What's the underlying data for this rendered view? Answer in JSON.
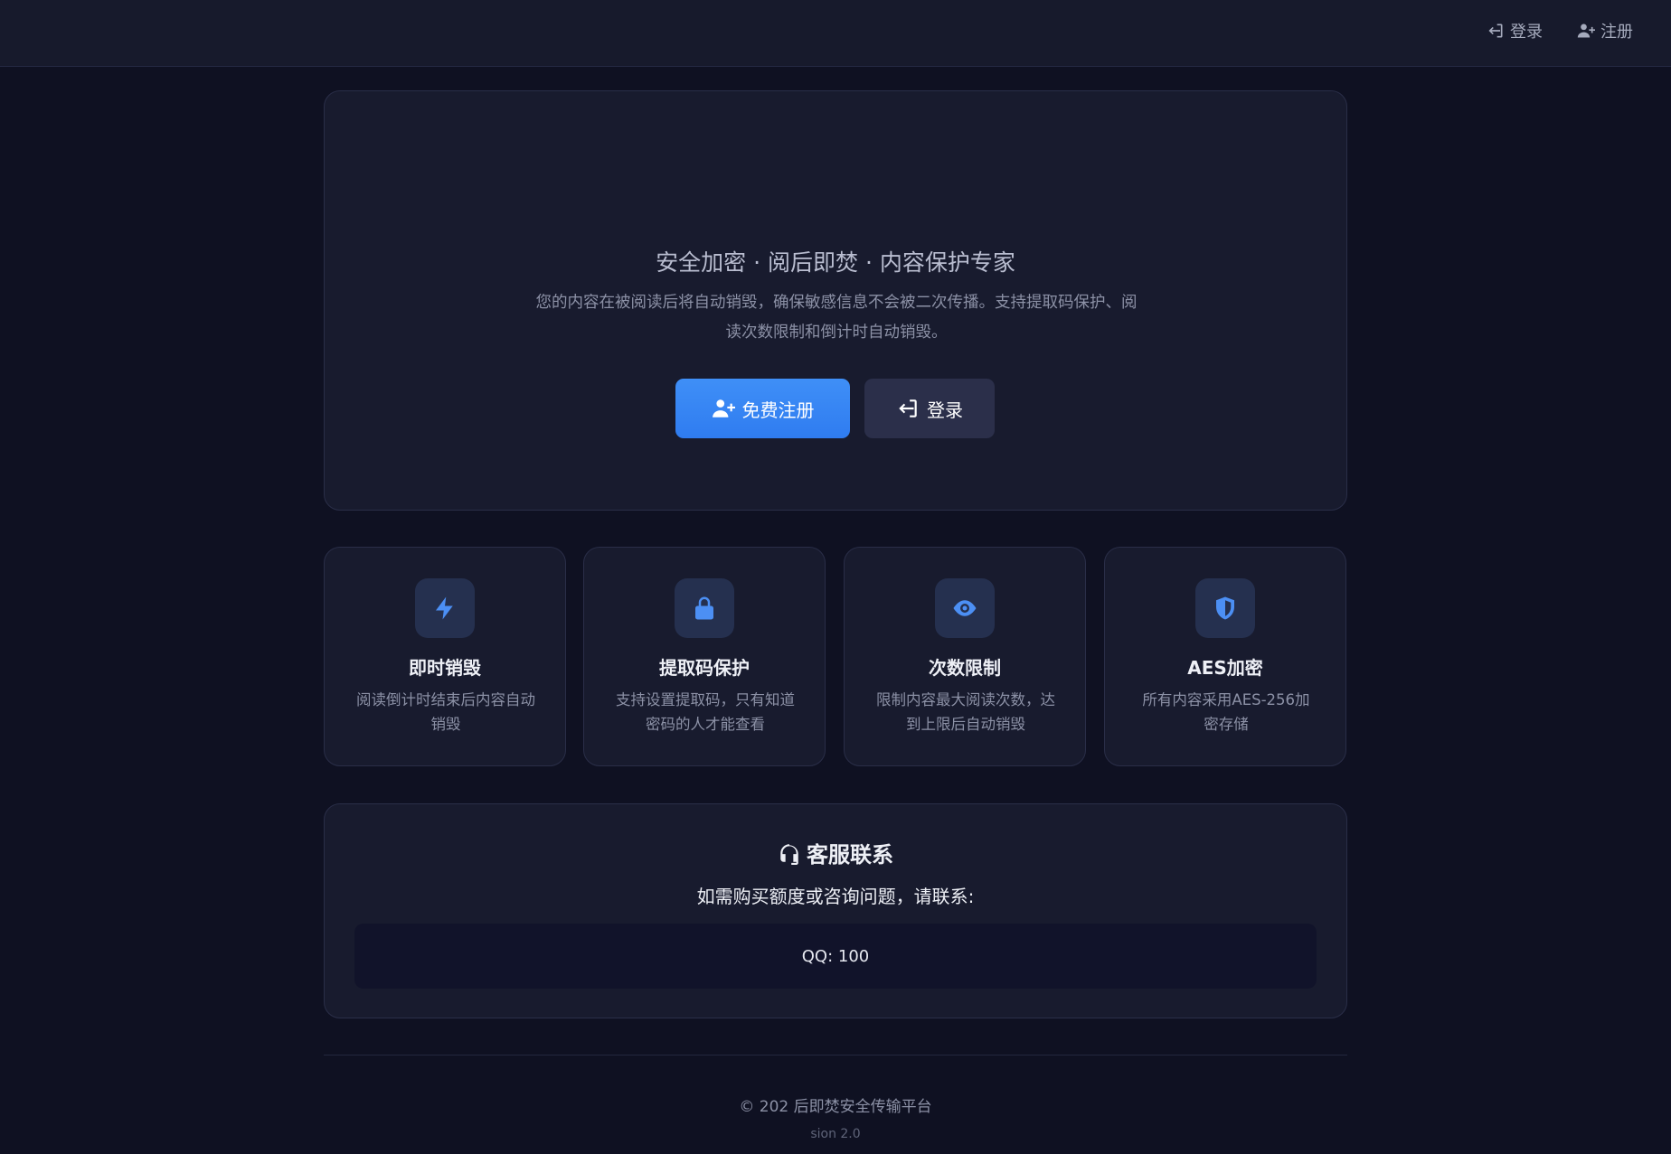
{
  "nav": {
    "login_label": "登录",
    "register_label": "注册"
  },
  "hero": {
    "title": "安全加密 · 阅后即焚 · 内容保护专家",
    "description": "您的内容在被阅读后将自动销毁，确保敏感信息不会被二次传播。支持提取码保护、阅读次数限制和倒计时自动销毁。",
    "register_button": "免费注册",
    "login_button": "登录"
  },
  "features": [
    {
      "icon": "bolt-icon",
      "title": "即时销毁",
      "desc": "阅读倒计时结束后内容自动销毁"
    },
    {
      "icon": "lock-icon",
      "title": "提取码保护",
      "desc": "支持设置提取码，只有知道密码的人才能查看"
    },
    {
      "icon": "eye-icon",
      "title": "次数限制",
      "desc": "限制内容最大阅读次数，达到上限后自动销毁"
    },
    {
      "icon": "shield-icon",
      "title": "AES加密",
      "desc": "所有内容采用AES-256加密存储"
    }
  ],
  "contact": {
    "title": "客服联系",
    "subtitle": "如需购买额度或咨询问题，请联系:",
    "qq": "QQ: 100"
  },
  "footer": {
    "copyright": "© 202 后即焚安全传输平台",
    "version": "sion 2.0"
  },
  "colors": {
    "accent": "#3f8ff7",
    "background": "#0f1122",
    "card": "#181b2e"
  }
}
